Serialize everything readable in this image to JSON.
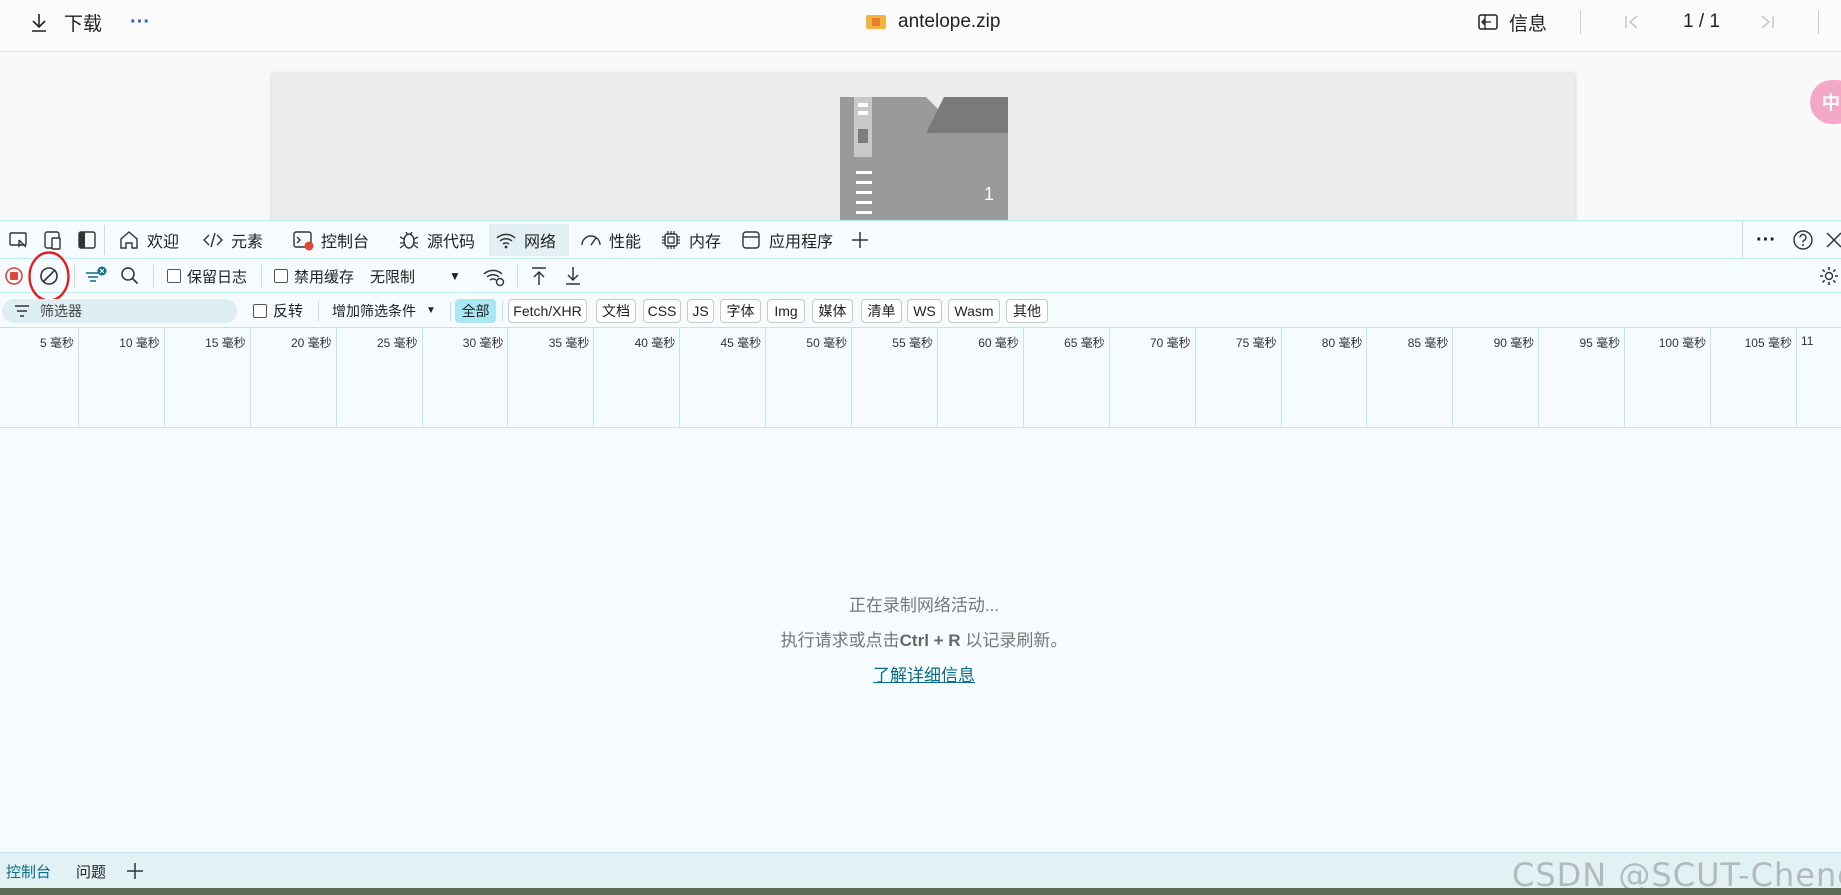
{
  "topbar": {
    "download_label": "下载",
    "more_label": "···",
    "filename": "antelope.zip",
    "info_label": "信息",
    "page_indicator": "1 / 1"
  },
  "preview": {
    "file_count_badge": "1",
    "pill_text": "中"
  },
  "devtools": {
    "tabs": [
      {
        "label": "欢迎",
        "icon": "home-icon"
      },
      {
        "label": "元素",
        "icon": "code-tag-icon"
      },
      {
        "label": "控制台",
        "icon": "console-icon"
      },
      {
        "label": "源代码",
        "icon": "bug-icon"
      },
      {
        "label": "网络",
        "icon": "wifi-icon"
      },
      {
        "label": "性能",
        "icon": "gauge-icon"
      },
      {
        "label": "内存",
        "icon": "chip-icon"
      },
      {
        "label": "应用程序",
        "icon": "window-icon"
      }
    ],
    "toolbar": {
      "preserve_log_label": "保留日志",
      "disable_cache_label": "禁用缓存",
      "throttle_label": "无限制"
    },
    "filter": {
      "placeholder": "筛选器",
      "invert_label": "反转",
      "add_condition_label": "增加筛选条件",
      "types": [
        "全部",
        "Fetch/XHR",
        "文档",
        "CSS",
        "JS",
        "字体",
        "Img",
        "媒体",
        "清单",
        "WS",
        "Wasm",
        "其他"
      ]
    },
    "timeline": {
      "unit": "毫秒",
      "ticks": [
        "5",
        "10",
        "15",
        "20",
        "25",
        "30",
        "35",
        "40",
        "45",
        "50",
        "55",
        "60",
        "65",
        "70",
        "75",
        "80",
        "85",
        "90",
        "95",
        "100",
        "105",
        "11"
      ]
    },
    "empty_state": {
      "line1": "正在录制网络活动...",
      "line2_prefix": "执行请求或点击",
      "line2_keys": "Ctrl + R",
      "line2_suffix": " 以记录刷新。",
      "link": "了解详细信息"
    },
    "drawer": {
      "console_label": "控制台",
      "issues_label": "问题"
    }
  },
  "watermark": "CSDN @SCUT-Cheng",
  "colors": {
    "accent": "#0a6c86",
    "record_red": "#e0443a",
    "active_chip": "#a9e7f5",
    "annotation_circle": "#e11f1f"
  }
}
